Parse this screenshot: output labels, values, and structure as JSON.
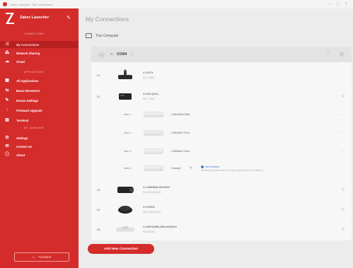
{
  "window": {
    "title": "Zaber Launcher - My Connections"
  },
  "sidebar": {
    "title": "Zaber Launcher",
    "sections": {
      "connections": "CONNECTIONS",
      "applications": "APPLICATIONS",
      "launcher": "MY LAUNCHER"
    },
    "items": [
      {
        "label": "My Connections",
        "icon": "link-icon"
      },
      {
        "label": "Network Sharing",
        "icon": "network-icon"
      },
      {
        "label": "Cloud",
        "icon": "cloud-icon"
      },
      {
        "label": "All Applications",
        "icon": "grid-icon"
      },
      {
        "label": "Basic Movement",
        "icon": "move-icon"
      },
      {
        "label": "Device Settings",
        "icon": "wrench-icon"
      },
      {
        "label": "Firmware Upgrade",
        "icon": "upload-icon"
      },
      {
        "label": "Terminal",
        "icon": "terminal-icon"
      },
      {
        "label": "Settings",
        "icon": "gear-icon"
      },
      {
        "label": "Contact Us",
        "icon": "chat-icon"
      },
      {
        "label": "About",
        "icon": "info-icon"
      }
    ],
    "feedback": "Feedback"
  },
  "main": {
    "title": "My Connections",
    "this_computer": "This Computer",
    "connection": {
      "name": "COM4"
    },
    "devices": [
      {
        "id": "01",
        "name": "X-JOY3",
        "sn": "SN: 37851"
      },
      {
        "id": "02",
        "name": "X-LDA (4x1)",
        "sn": "SN: 77853"
      }
    ],
    "axes": [
      {
        "label": "Axis 1",
        "part": "LSD00501TIBA"
      },
      {
        "label": "Axis 2",
        "part": "LSD0604-T11A"
      },
      {
        "label": "Axis 3",
        "part": "LSD0604-T11A"
      },
      {
        "label": "Axis 4",
        "part": "Unused",
        "status_title": "Not Detected",
        "status_desc": "Connect a peripheral then run the peripheral ID tool to detect it"
      }
    ],
    "devices2": [
      {
        "id": "03",
        "name": "X-LSM050A-MO0012",
        "sn": "SN: 833042/393"
      },
      {
        "id": "04",
        "name": "X-FCR0C",
        "sn": "SN: 833042/301"
      },
      {
        "id": "05",
        "name": "X-ASR100B120B-MO0013",
        "sn": "SN: 80049"
      }
    ],
    "add_button": "Add New Connection"
  },
  "colors": {
    "brand": "#d42b2b",
    "brand_dark": "#b82020",
    "status_blue": "#3a82d6"
  }
}
